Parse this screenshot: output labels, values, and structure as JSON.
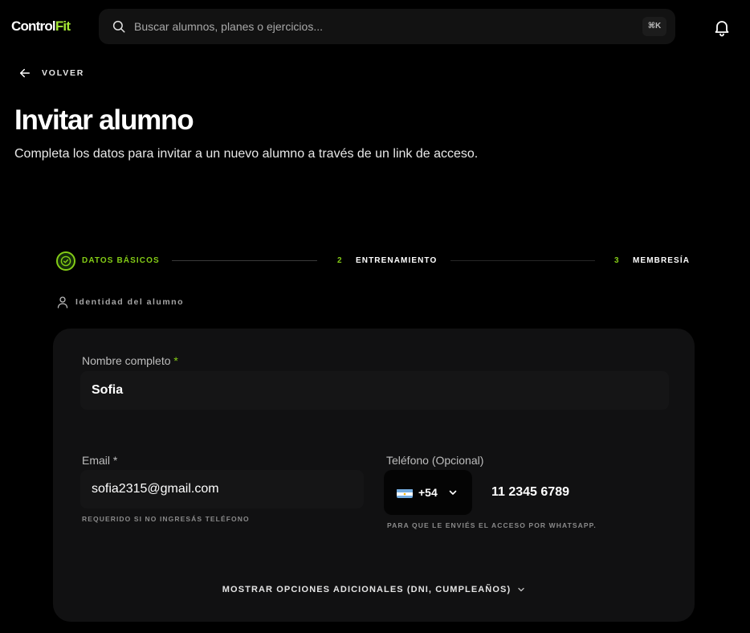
{
  "app": {
    "logo_part1": "Control",
    "logo_part2": "Fit"
  },
  "search": {
    "placeholder": "Buscar alumnos, planes o ejercicios...",
    "shortcut": "⌘K"
  },
  "nav": {
    "back_label": "VOLVER"
  },
  "page": {
    "title": "Invitar alumno",
    "subtitle": "Completa los datos para invitar a un nuevo alumno a través de un link de acceso."
  },
  "stepper": {
    "steps": [
      {
        "number": "",
        "label": "DATOS BÁSICOS",
        "state": "active"
      },
      {
        "number": "2",
        "label": "ENTRENAMIENTO",
        "state": "pending"
      },
      {
        "number": "3",
        "label": "MEMBRESÍA",
        "state": "pending"
      }
    ]
  },
  "section": {
    "label": "Identidad del alumno"
  },
  "form": {
    "name": {
      "label": "Nombre completo",
      "required_mark": "*",
      "value": "Sofia"
    },
    "email": {
      "label": "Email",
      "required_mark": "*",
      "value": "sofia2315@gmail.com",
      "hint": "REQUERIDO SI NO INGRESÁS TELÉFONO"
    },
    "phone": {
      "label": "Teléfono (Opcional)",
      "country_code": "+54",
      "value": "11 2345 6789",
      "hint": "PARA QUE LE ENVIÉS EL ACCESO POR WHATSAPP."
    },
    "more_options": "MOSTRAR OPCIONES ADICIONALES (DNI, CUMPLEAÑOS)"
  },
  "colors": {
    "accent": "#84cc16",
    "logo_accent": "#a3e635",
    "background": "#000000",
    "card": "#111112"
  }
}
